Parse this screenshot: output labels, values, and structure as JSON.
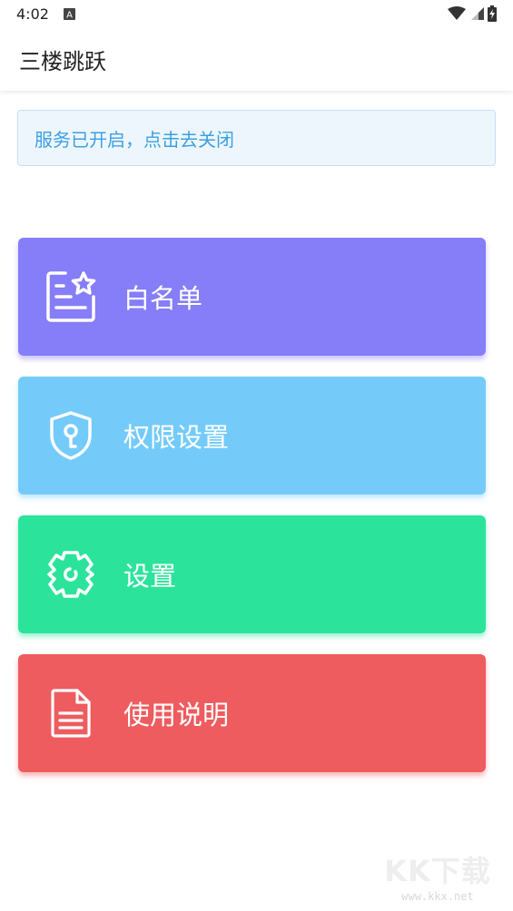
{
  "status_bar": {
    "time": "4:02",
    "notification_icon": "a-letter-icon",
    "icons": [
      "wifi-icon",
      "cellular-icon",
      "battery-charging-icon"
    ]
  },
  "app_bar": {
    "title": "三楼跳跃"
  },
  "notice": {
    "text": "服务已开启，点击去关闭"
  },
  "menu": [
    {
      "label": "白名单",
      "icon": "whitelist-star-icon",
      "color": "#867df9"
    },
    {
      "label": "权限设置",
      "icon": "shield-key-icon",
      "color": "#74cbfa"
    },
    {
      "label": "设置",
      "icon": "gear-icon",
      "color": "#2ce39b"
    },
    {
      "label": "使用说明",
      "icon": "document-icon",
      "color": "#ee5c5f"
    }
  ],
  "watermark": {
    "main": "KK下载",
    "sub": "www.kkx.net"
  }
}
